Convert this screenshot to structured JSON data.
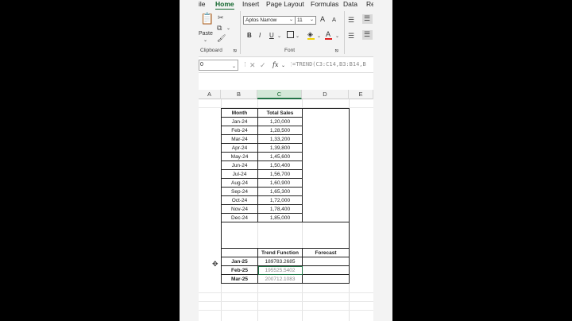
{
  "menu": {
    "tabs": [
      {
        "label": "ile",
        "active": false
      },
      {
        "label": "Home",
        "active": true
      },
      {
        "label": "Insert",
        "active": false
      },
      {
        "label": "Page Layout",
        "active": false
      },
      {
        "label": "Formulas",
        "active": false
      },
      {
        "label": "Data",
        "active": false
      },
      {
        "label": "Re",
        "active": false
      }
    ]
  },
  "ribbon": {
    "paste_label": "Paste",
    "clipboard_label": "Clipboard",
    "font_group_label": "Font",
    "font_name": "Aptos Narrow",
    "font_size": "11",
    "grow_font": "A",
    "shrink_font": "A",
    "bold": "B",
    "italic": "I",
    "underline": "U",
    "font_color_letter": "A"
  },
  "formula_bar": {
    "name_box": "0",
    "fx_label": "fx",
    "formula": "=TREND(C3:C14,B3:B14,B"
  },
  "columns": [
    "A",
    "B",
    "C",
    "D",
    "E"
  ],
  "table": {
    "headers": [
      "Month",
      "Total Sales"
    ],
    "rows": [
      [
        "Jan-24",
        "1,20,000"
      ],
      [
        "Feb-24",
        "1,28,500"
      ],
      [
        "Mar-24",
        "1,33,200"
      ],
      [
        "Apr-24",
        "1,39,800"
      ],
      [
        "May-24",
        "1,45,600"
      ],
      [
        "Jun-24",
        "1,50,400"
      ],
      [
        "Jul-24",
        "1,56,700"
      ],
      [
        "Aug-24",
        "1,60,900"
      ],
      [
        "Sep-24",
        "1,65,300"
      ],
      [
        "Oct-24",
        "1,72,000"
      ],
      [
        "Nov-24",
        "1,78,400"
      ],
      [
        "Dec-24",
        "1,85,000"
      ]
    ],
    "forecast_headers": [
      "Trend Function",
      "Forecast"
    ],
    "forecast_rows": [
      [
        "Jan-25",
        "189783.2685",
        ""
      ],
      [
        "Feb-25",
        "195525.5402",
        ""
      ],
      [
        "Mar-25",
        "200712.1083",
        ""
      ]
    ]
  },
  "colors": {
    "accent": "#217346",
    "selected_header": "#d3e8d8",
    "ribbon_bg": "#f3f3f3"
  },
  "icons": [
    "paste-icon",
    "cut-icon",
    "copy-icon",
    "format-painter-icon",
    "border-icon",
    "fill-color-icon",
    "font-color-icon",
    "align-left-icon",
    "align-center-icon",
    "cancel-icon",
    "enter-icon",
    "fx-icon",
    "cursor-icon"
  ]
}
